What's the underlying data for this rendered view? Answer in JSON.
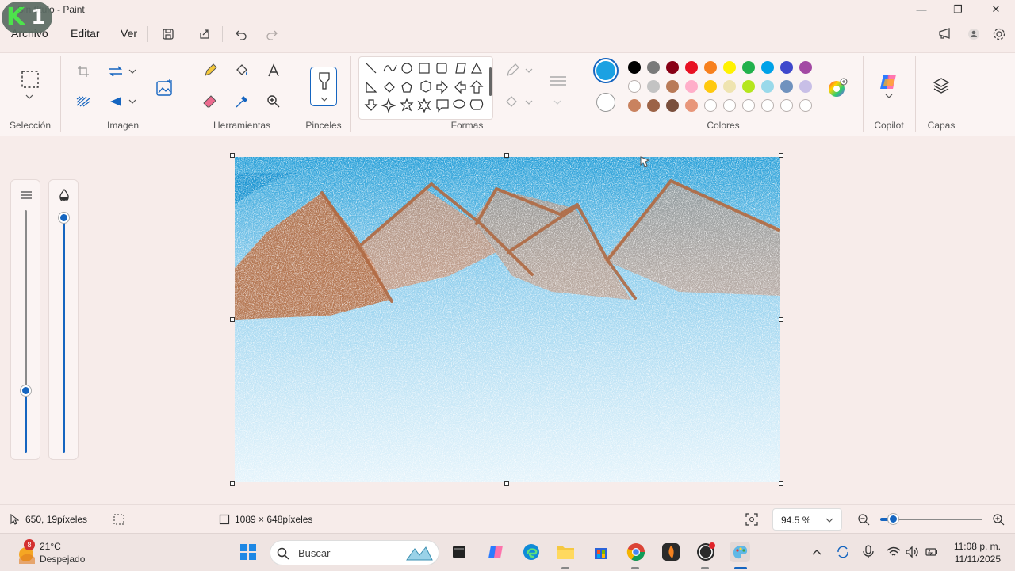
{
  "app": {
    "title": "Sin título - Paint",
    "logo_k": "K",
    "logo_num": "1"
  },
  "window_controls": {
    "minimize": "—",
    "maximize": "❐",
    "close": "✕"
  },
  "menu": {
    "file": "Archivo",
    "edit": "Editar",
    "view": "Ver"
  },
  "ribbon": {
    "groups": {
      "selection": "Selección",
      "image": "Imagen",
      "tools": "Herramientas",
      "brushes": "Pinceles",
      "shapes": "Formas",
      "colors": "Colores",
      "copilot": "Copilot",
      "layers": "Capas"
    },
    "colors": {
      "primary": "#1ba1e2",
      "secondary": "#ffffff",
      "row1": [
        "#000000",
        "#7a7a7a",
        "#880015",
        "#e81123",
        "#f7801e",
        "#fff200",
        "#22b14c",
        "#00a2e8",
        "#3f48cc",
        "#a349a4"
      ],
      "row2": [
        "#ffffff",
        "#c3c3c3",
        "#b97a57",
        "#ffaec9",
        "#ffc90e",
        "#efe4b0",
        "#b5e61d",
        "#99d9ea",
        "#7092be",
        "#c8bfe7"
      ],
      "row3": [
        "#c9825f",
        "#9c6347",
        "#7a4f3c",
        "#e8967a",
        "",
        "",
        "",
        "",
        "",
        ""
      ]
    }
  },
  "status": {
    "cursor_pos": "650, 19píxeles",
    "canvas_size": "1089 × 648píxeles",
    "zoom": "94.5 %",
    "zoom_level": 0.45
  },
  "taskbar": {
    "weather_temp": "21°C",
    "weather_desc": "Despejado",
    "weather_badge": "8",
    "search_placeholder": "Buscar",
    "time": "11:08 p. m.",
    "date": "11/11/2025"
  }
}
